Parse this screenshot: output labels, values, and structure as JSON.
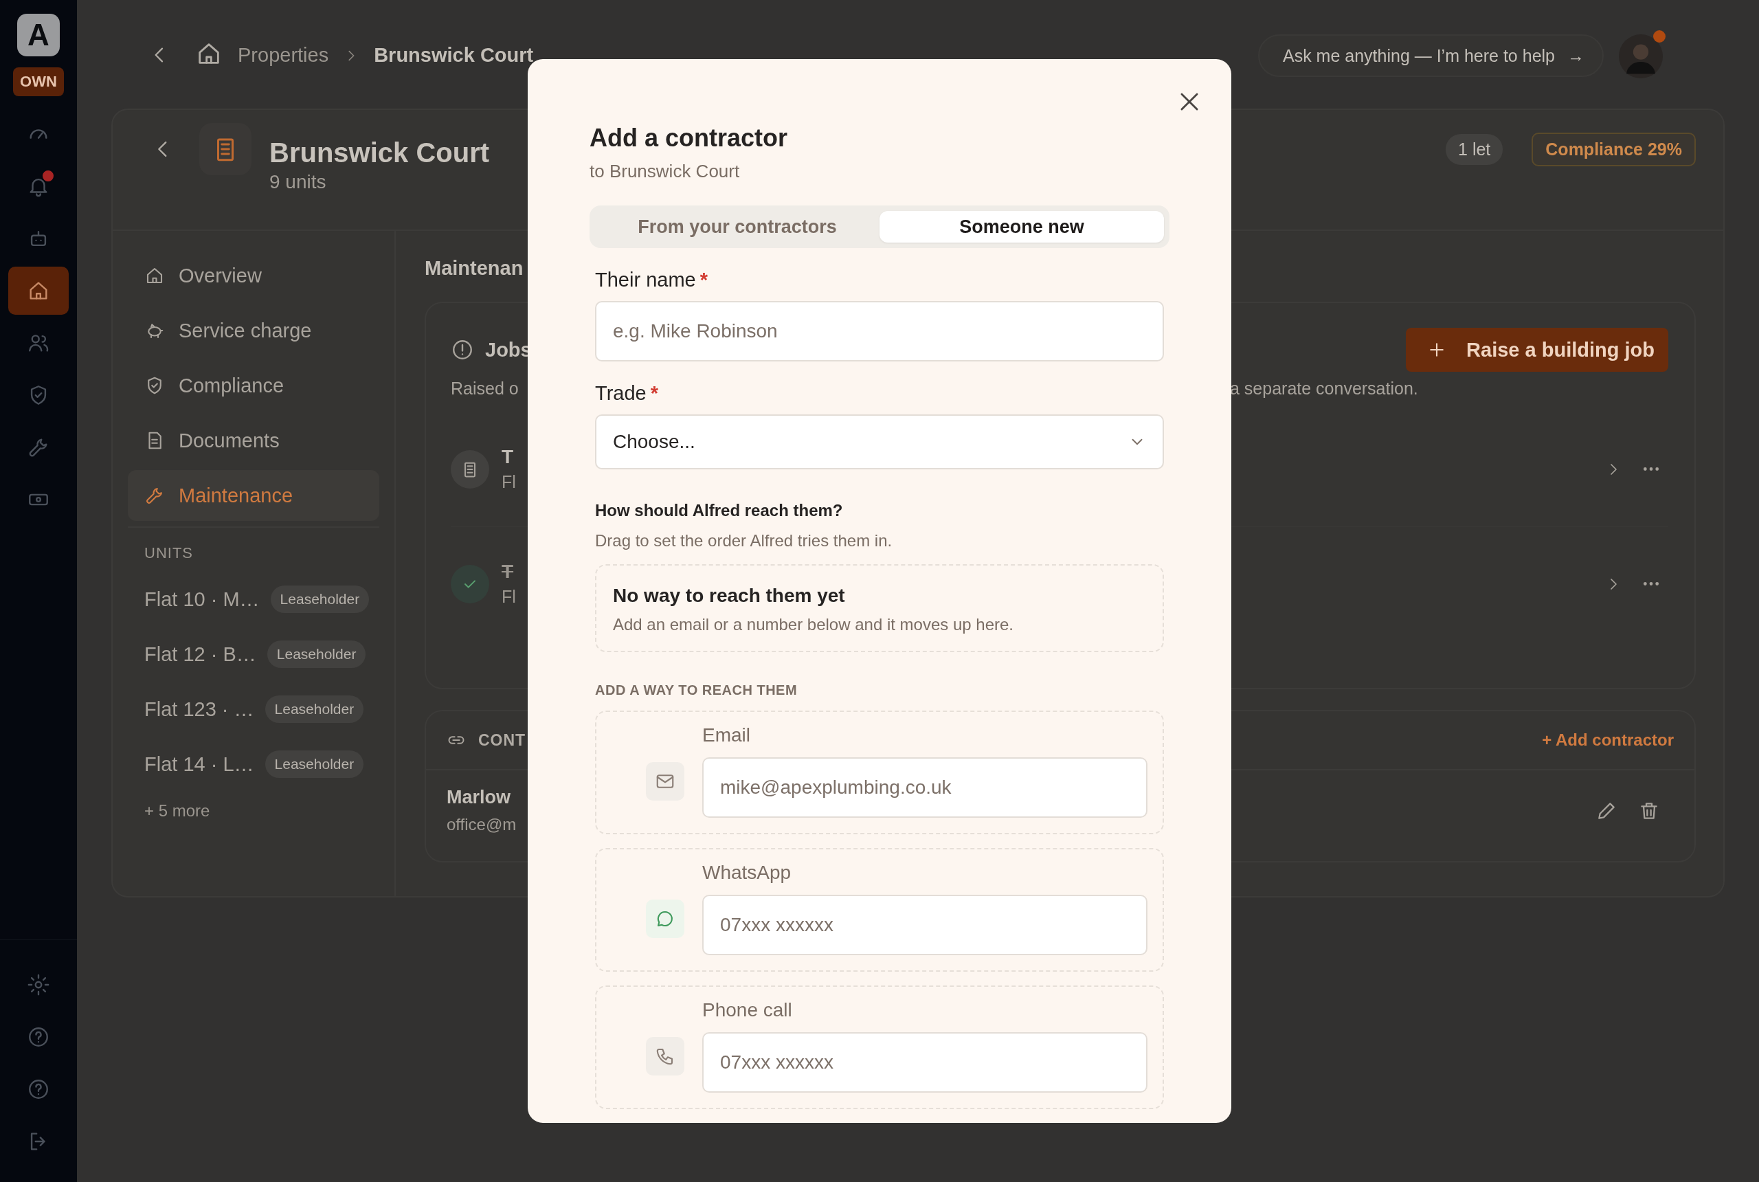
{
  "rail": {
    "logo": "A",
    "badge": "OWN",
    "items": [
      {
        "selected": false,
        "alert": false
      },
      {
        "selected": false,
        "alert": true
      },
      {
        "selected": false,
        "alert": false
      },
      {
        "selected": true,
        "alert": false
      },
      {
        "selected": false,
        "alert": false
      },
      {
        "selected": false,
        "alert": false
      },
      {
        "selected": false,
        "alert": false
      },
      {
        "selected": false,
        "alert": false
      }
    ],
    "bottom_items": [
      {
        "selected": false
      },
      {
        "selected": false
      },
      {
        "selected": false
      },
      {
        "selected": false
      }
    ]
  },
  "breadcrumb": {
    "items": [
      "Properties",
      "Brunswick Court"
    ]
  },
  "assistant": {
    "prompt": "Ask me anything — I’m here to help",
    "arrow": "→",
    "alert": true
  },
  "property": {
    "name": "Brunswick Court",
    "subtitle": "9 units",
    "badges": [
      {
        "label": "1 let",
        "kind": "neutral"
      },
      {
        "label": "Compliance 29%",
        "kind": "warning"
      }
    ]
  },
  "nav": {
    "items": [
      {
        "label": "Overview",
        "selected": false
      },
      {
        "label": "Service charge",
        "selected": false
      },
      {
        "label": "Compliance",
        "selected": false
      },
      {
        "label": "Documents",
        "selected": false
      },
      {
        "label": "Maintenance",
        "selected": true
      }
    ]
  },
  "units": {
    "heading": "UNITS",
    "items": [
      {
        "name": "Flat 10 · M…",
        "tag": "Leaseholder"
      },
      {
        "name": "Flat 12 · B…",
        "tag": "Leaseholder"
      },
      {
        "name": "Flat 123 · …",
        "tag": "Leaseholder"
      },
      {
        "name": "Flat 14 · L…",
        "tag": "Leaseholder"
      }
    ],
    "more": "+ 5 more"
  },
  "main": {
    "heading": "Maintenan",
    "jobs": {
      "title": "Jobs",
      "note_left": "Raised o",
      "note_right": "a separate conversation.",
      "button": "Raise a building job",
      "rows": [
        {
          "title": "T",
          "subtitle": "Fl",
          "done": false
        },
        {
          "title": "T",
          "subtitle": "Fl",
          "done": true
        }
      ]
    },
    "contractors": {
      "title": "CONT",
      "add": "+ Add contractor",
      "rows": [
        {
          "name": "Marlow",
          "email": "office@m"
        }
      ]
    }
  },
  "modal": {
    "title": "Add a contractor",
    "subtitle": "to Brunswick Court",
    "tabs": [
      {
        "label": "From your contractors",
        "selected": false
      },
      {
        "label": "Someone new",
        "selected": true
      }
    ],
    "name_field": {
      "label": "Their name",
      "required_mark": "*",
      "placeholder": "e.g. Mike Robinson"
    },
    "trade_field": {
      "label": "Trade",
      "required_mark": "*",
      "value": "Choose..."
    },
    "reach": {
      "heading": "How should Alfred reach them?",
      "hint": "Drag to set the order Alfred tries them in.",
      "empty_title": "No way to reach them yet",
      "empty_text": "Add an email or a number below and it moves up here."
    },
    "add_heading": "ADD A WAY TO REACH THEM",
    "methods": [
      {
        "label": "Email",
        "placeholder": "mike@apexplumbing.co.uk"
      },
      {
        "label": "WhatsApp",
        "placeholder": "07xxx xxxxxx"
      },
      {
        "label": "Phone call",
        "placeholder": "07xxx xxxxxx"
      }
    ]
  }
}
